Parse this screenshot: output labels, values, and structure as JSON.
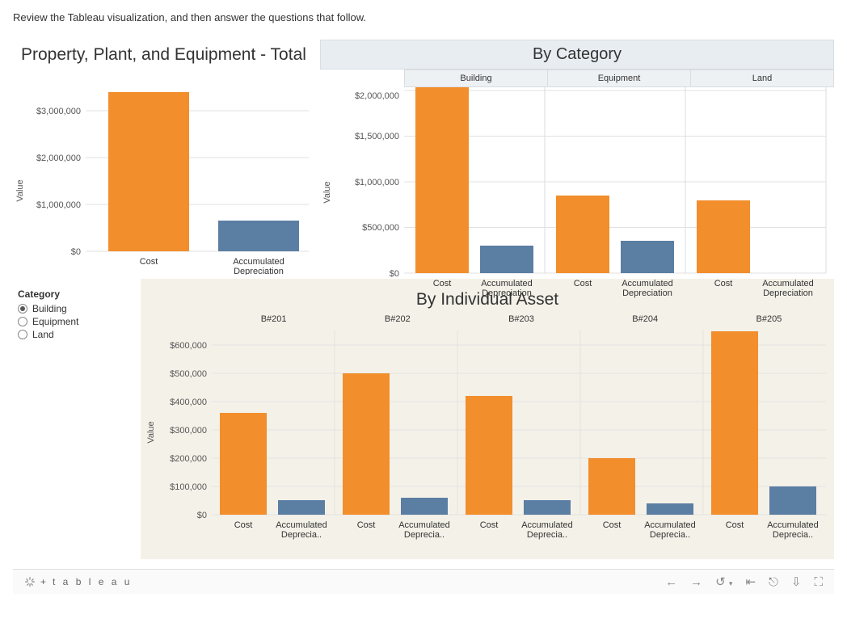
{
  "instruction": "Review the Tableau visualization, and then answer the questions that follow.",
  "chart_total": {
    "title": "Property, Plant, and Equipment - Total",
    "ylabel": "Value"
  },
  "chart_category": {
    "title": "By Category",
    "ylabel": "Value"
  },
  "chart_asset": {
    "title": "By Individual Asset",
    "ylabel": "Value"
  },
  "filter": {
    "title": "Category",
    "options": [
      "Building",
      "Equipment",
      "Land"
    ],
    "selected": "Building"
  },
  "footer": {
    "brand": "t a b l e a u"
  },
  "chart_data": [
    {
      "name": "Property, Plant, and Equipment - Total",
      "type": "bar",
      "categories": [
        "Cost",
        "Accumulated Depreciation"
      ],
      "values": [
        3400000,
        650000
      ],
      "ylabel": "Value",
      "ylim": [
        0,
        3500000
      ],
      "yticks": [
        "$0",
        "$1,000,000",
        "$2,000,000",
        "$3,000,000"
      ],
      "colors": {
        "Cost": "#f28e2b",
        "Accumulated Depreciation": "#5b7ea3"
      }
    },
    {
      "name": "By Category",
      "type": "bar",
      "facets": [
        "Building",
        "Equipment",
        "Land"
      ],
      "categories": [
        "Cost",
        "Accumulated Depreciation"
      ],
      "series": [
        {
          "facet": "Building",
          "values": [
            2100000,
            300000
          ]
        },
        {
          "facet": "Equipment",
          "values": [
            850000,
            350000
          ]
        },
        {
          "facet": "Land",
          "values": [
            800000,
            0
          ]
        }
      ],
      "ylabel": "Value",
      "ylim": [
        0,
        2100000
      ],
      "yticks": [
        "$0",
        "$500,000",
        "$1,000,000",
        "$1,500,000",
        "$2,000,000"
      ],
      "colors": {
        "Cost": "#f28e2b",
        "Accumulated Depreciation": "#5b7ea3"
      }
    },
    {
      "name": "By Individual Asset",
      "type": "bar",
      "facets": [
        "B#201",
        "B#202",
        "B#203",
        "B#204",
        "B#205"
      ],
      "categories": [
        "Cost",
        "Accumulated Deprecia.."
      ],
      "series": [
        {
          "facet": "B#201",
          "values": [
            360000,
            50000
          ]
        },
        {
          "facet": "B#202",
          "values": [
            500000,
            60000
          ]
        },
        {
          "facet": "B#203",
          "values": [
            420000,
            50000
          ]
        },
        {
          "facet": "B#204",
          "values": [
            200000,
            40000
          ]
        },
        {
          "facet": "B#205",
          "values": [
            650000,
            100000
          ]
        }
      ],
      "ylabel": "Value",
      "ylim": [
        0,
        680000
      ],
      "yticks": [
        "$0",
        "$100,000",
        "$200,000",
        "$300,000",
        "$400,000",
        "$500,000",
        "$600,000"
      ],
      "colors": {
        "Cost": "#f28e2b",
        "Accumulated Deprecia..": "#5b7ea3"
      }
    }
  ]
}
